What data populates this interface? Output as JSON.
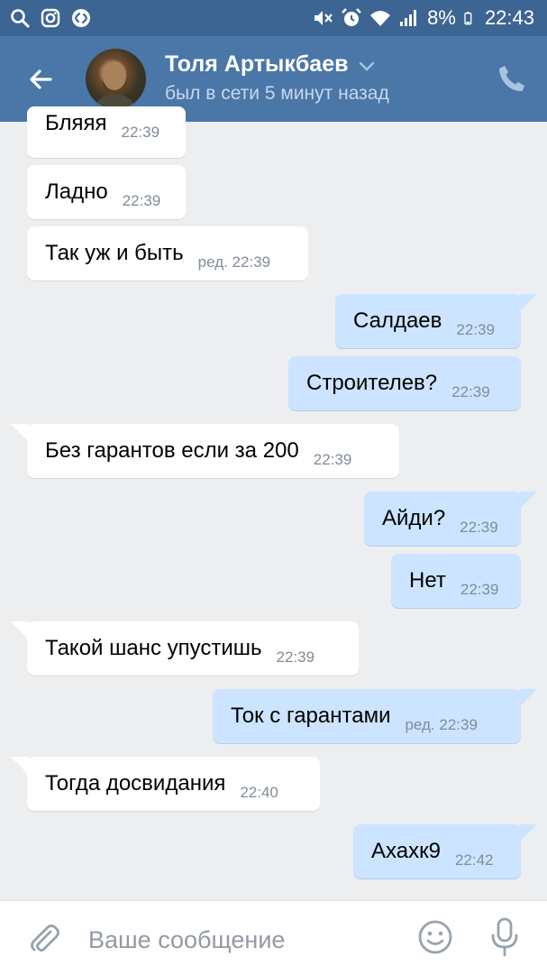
{
  "status_bar": {
    "battery": "8%",
    "time": "22:43",
    "left_icons": [
      "search-icon",
      "instagram-icon",
      "shazam-icon"
    ],
    "right_icons": [
      "mute-icon",
      "alarm-icon",
      "wifi-icon",
      "signal-icon",
      "battery-icon"
    ]
  },
  "header": {
    "contact_name": "Толя Артыкбаев",
    "status": "был в сети 5 минут назад",
    "back_icon": "arrow-left-icon",
    "call_icon": "phone-icon",
    "dropdown_icon": "chevron-down-icon"
  },
  "messages": [
    {
      "direction": "in",
      "text": "Бляяя",
      "time": "22:39"
    },
    {
      "direction": "in",
      "text": "Ладно",
      "time": "22:39"
    },
    {
      "direction": "in",
      "text": "Так уж и быть",
      "time": "ред. 22:39"
    },
    {
      "direction": "out",
      "text": "Салдаев",
      "time": "22:39"
    },
    {
      "direction": "out",
      "text": "Строителев?",
      "time": "22:39"
    },
    {
      "direction": "in",
      "text": "Без гарантов если за 200",
      "time": "22:39"
    },
    {
      "direction": "out",
      "text": "Айди?",
      "time": "22:39"
    },
    {
      "direction": "out",
      "text": "Нет",
      "time": "22:39"
    },
    {
      "direction": "in",
      "text": "Такой шанс упустишь",
      "time": "22:39"
    },
    {
      "direction": "out",
      "text": "Ток с гарантами",
      "time": "ред. 22:39"
    },
    {
      "direction": "in",
      "text": "Тогда досвидания",
      "time": "22:40"
    },
    {
      "direction": "out",
      "text": "Ахахк9",
      "time": "22:42"
    }
  ],
  "composer": {
    "placeholder": "Ваше сообщение",
    "value": "",
    "attach_icon": "paperclip-icon",
    "emoji_icon": "smile-icon",
    "mic_icon": "microphone-icon"
  },
  "colors": {
    "status_bar": "#3d6593",
    "header": "#4a76a8",
    "background": "#edeef0",
    "incoming_bubble": "#ffffff",
    "outgoing_bubble": "#cce4ff",
    "timestamp": "#818c99"
  }
}
